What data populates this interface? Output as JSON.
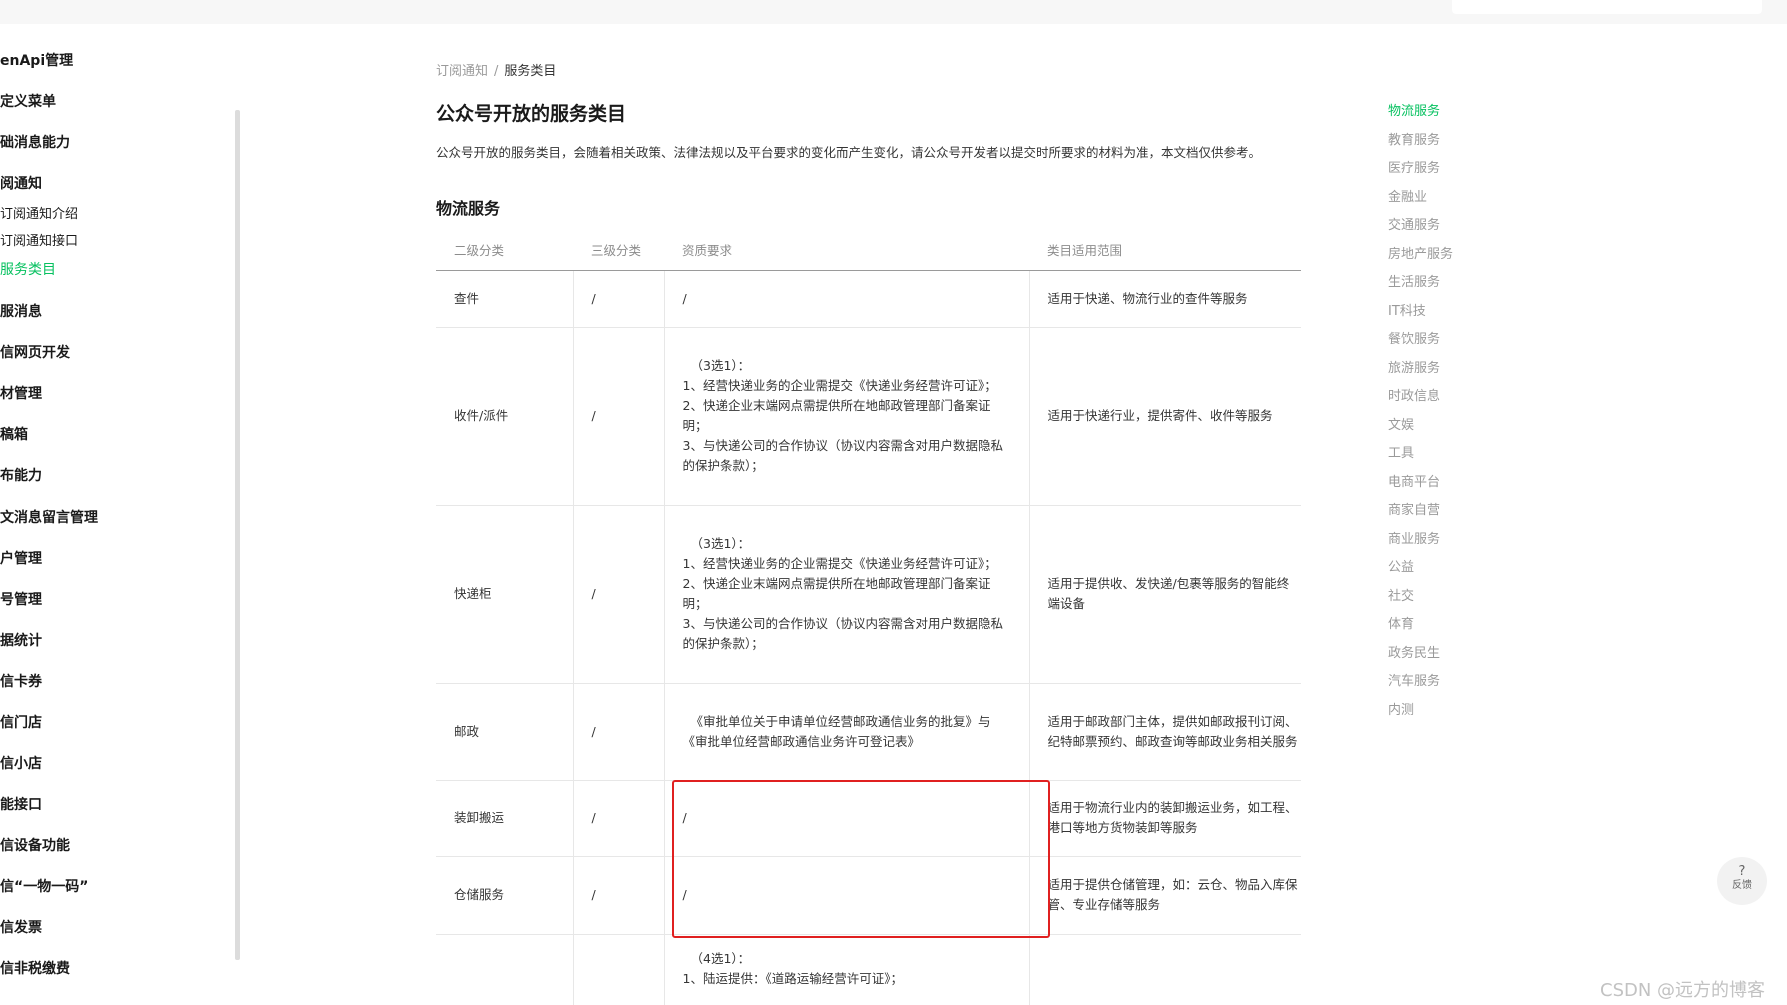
{
  "sidebar": {
    "items": [
      {
        "label": "enApi管理",
        "style": "main"
      },
      {
        "label": "定义菜单",
        "style": "main"
      },
      {
        "label": "础消息能力",
        "style": "main"
      },
      {
        "label": "阅通知",
        "style": "main"
      },
      {
        "label": "订阅通知介绍",
        "style": "sub"
      },
      {
        "label": "订阅通知接口",
        "style": "sub"
      },
      {
        "label": "服务类目",
        "style": "active"
      },
      {
        "label": "服消息",
        "style": "main"
      },
      {
        "label": "信网页开发",
        "style": "main"
      },
      {
        "label": "材管理",
        "style": "main"
      },
      {
        "label": "稿箱",
        "style": "main"
      },
      {
        "label": "布能力",
        "style": "main"
      },
      {
        "label": "文消息留言管理",
        "style": "main"
      },
      {
        "label": "户管理",
        "style": "main"
      },
      {
        "label": "号管理",
        "style": "main"
      },
      {
        "label": "据统计",
        "style": "main"
      },
      {
        "label": "信卡券",
        "style": "main"
      },
      {
        "label": "信门店",
        "style": "main"
      },
      {
        "label": "信小店",
        "style": "main"
      },
      {
        "label": "能接口",
        "style": "main"
      },
      {
        "label": "信设备功能",
        "style": "main"
      },
      {
        "label": "信“一物一码”",
        "style": "main"
      },
      {
        "label": "信发票",
        "style": "main"
      },
      {
        "label": "信非税缴费",
        "style": "main"
      }
    ]
  },
  "breadcrumb": {
    "parent": "订阅通知",
    "separator": "/",
    "current": "服务类目"
  },
  "page": {
    "title": "公众号开放的服务类目",
    "intro": "公众号开放的服务类目，会随着相关政策、法律法规以及平台要求的变化而产生变化，请公众号开发者以提交时所要求的材料为准，本文档仅供参考。",
    "section_title": "物流服务"
  },
  "table": {
    "headers": [
      "二级分类",
      "三级分类",
      "资质要求",
      "类目适用范围"
    ],
    "rows": [
      {
        "c1": "查件",
        "c2": "/",
        "req": [
          "/"
        ],
        "scope": "适用于快递、物流行业的查件等服务"
      },
      {
        "c1": "收件/派件",
        "c2": "/",
        "req": [
          "（3选1）：",
          "1、经营快递业务的企业需提交《快递业务经营许可证》；",
          "2、快递企业末端网点需提供所在地邮政管理部门备案证",
          "明；",
          "3、与快递公司的合作协议（协议内容需含对用户数据隐私",
          "的保护条款）；"
        ],
        "scope": "适用于快递行业，提供寄件、收件等服务"
      },
      {
        "c1": "快递柜",
        "c2": "/",
        "req": [
          "（3选1）：",
          "1、经营快递业务的企业需提交《快递业务经营许可证》；",
          "2、快递企业末端网点需提供所在地邮政管理部门备案证",
          "明；",
          "3、与快递公司的合作协议（协议内容需含对用户数据隐私",
          "的保护条款）；"
        ],
        "scope": "适用于提供收、发快递/包裹等服务的智能终端设备"
      },
      {
        "c1": "邮政",
        "c2": "/",
        "req": [
          "《审批单位关于申请单位经营邮政通信业务的批复》与",
          "《审批单位经营邮政通信业务许可登记表》"
        ],
        "scope": "适用于邮政部门主体，提供如邮政报刊订阅、纪特邮票预约、邮政查询等邮政业务相关服务"
      },
      {
        "c1": "装卸搬运",
        "c2": "/",
        "req": [
          "/"
        ],
        "scope": "适用于物流行业内的装卸搬运业务，如工程、港口等地方货物装卸等服务"
      },
      {
        "c1": "仓储服务",
        "c2": "/",
        "req": [
          "/"
        ],
        "scope": "适用于提供仓储管理，如：云仓、物品入库保管、专业存储等服务"
      },
      {
        "c1": "",
        "c2": "",
        "req": [
          "（4选1）：",
          "1、陆运提供：《道路运输经营许可证》；"
        ],
        "scope": ""
      }
    ]
  },
  "toc": {
    "items": [
      "物流服务",
      "教育服务",
      "医疗服务",
      "金融业",
      "交通服务",
      "房地产服务",
      "生活服务",
      "IT科技",
      "餐饮服务",
      "旅游服务",
      "时政信息",
      "文娱",
      "工具",
      "电商平台",
      "商家自营",
      "商业服务",
      "公益",
      "社交",
      "体育",
      "政务民生",
      "汽车服务",
      "内测"
    ]
  },
  "feedback": {
    "symbol": "?",
    "label": "反馈"
  },
  "watermark": "CSDN @远方的博客",
  "colors": {
    "accent": "#07c160",
    "highlight": "#e02020",
    "muted": "#9a9a9a"
  }
}
